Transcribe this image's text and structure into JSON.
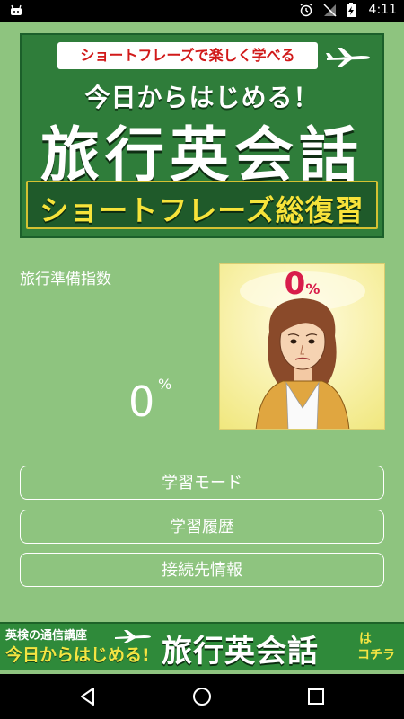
{
  "statusbar": {
    "time": "4:11"
  },
  "banner": {
    "top_text": "ショートフレーズで楽しく学べる",
    "subtitle": "今日からはじめる！",
    "title": "旅行英会話",
    "ribbon": "ショートフレーズ総復習"
  },
  "index": {
    "label": "旅行準備指数",
    "value": "0",
    "unit": "%"
  },
  "portrait": {
    "percent_value": "0",
    "percent_unit": "%"
  },
  "menu": {
    "study_mode": "学習モード",
    "study_history": "学習履歴",
    "connection_info": "接続先情報"
  },
  "ad": {
    "small": "英検の通信講座",
    "sub": "今日からはじめる!",
    "main": "旅行英会話",
    "ha": "は",
    "kochira": "コチラ"
  },
  "colors": {
    "background": "#8ec47f",
    "banner_green": "#2f7d3a",
    "accent_red": "#d81c4a",
    "accent_yellow": "#f4e542"
  }
}
